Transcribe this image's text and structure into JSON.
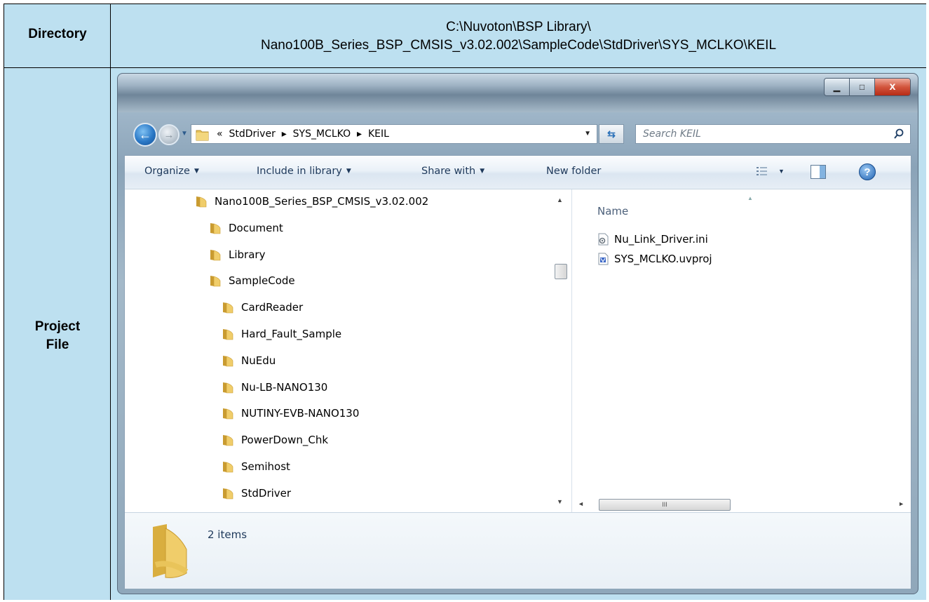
{
  "table": {
    "directory_label": "Directory",
    "directory_path_line1": "C:\\Nuvoton\\BSP Library\\",
    "directory_path_line2": "Nano100B_Series_BSP_CMSIS_v3.02.002\\SampleCode\\StdDriver\\SYS_MCLKO\\KEIL",
    "project_label_line1": "Project",
    "project_label_line2": "File"
  },
  "window": {
    "address": {
      "overflow": "«",
      "crumbs": [
        "StdDriver",
        "SYS_MCLKO",
        "KEIL"
      ],
      "separator": "▸"
    },
    "search_placeholder": "Search KEIL",
    "controls": {
      "minimize": "▁",
      "maximize": "□",
      "close": "x"
    },
    "toolbar": {
      "organize": "Organize",
      "include_in_library": "Include in library",
      "share_with": "Share with",
      "new_folder": "New folder"
    },
    "tree": [
      {
        "label": "Nano100B_Series_BSP_CMSIS_v3.02.002",
        "level": 0
      },
      {
        "label": "Document",
        "level": 1
      },
      {
        "label": "Library",
        "level": 1
      },
      {
        "label": "SampleCode",
        "level": 1
      },
      {
        "label": "CardReader",
        "level": 2
      },
      {
        "label": "Hard_Fault_Sample",
        "level": 2
      },
      {
        "label": "NuEdu",
        "level": 2
      },
      {
        "label": "Nu-LB-NANO130",
        "level": 2
      },
      {
        "label": "NUTINY-EVB-NANO130",
        "level": 2
      },
      {
        "label": "PowerDown_Chk",
        "level": 2
      },
      {
        "label": "Semihost",
        "level": 2
      },
      {
        "label": "StdDriver",
        "level": 2
      }
    ],
    "content": {
      "column_name": "Name",
      "files": [
        {
          "name": "Nu_Link_Driver.ini",
          "icon": "ini-file-icon"
        },
        {
          "name": "SYS_MCLKO.uvproj",
          "icon": "uvproj-file-icon"
        }
      ]
    },
    "status": {
      "item_count": "2 items"
    },
    "colors": {
      "folder": "#e8c45a",
      "accent": "#1e395b"
    }
  }
}
